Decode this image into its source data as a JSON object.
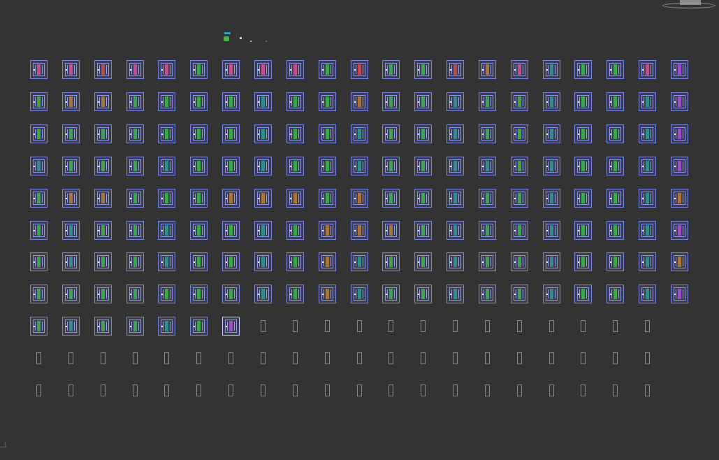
{
  "viewport": {
    "background": "#333333"
  },
  "colors": {
    "frame": "#7a84dd",
    "bar_green": "#3aa84a",
    "bar_pink": "#c24f8a",
    "bar_red": "#c0484c",
    "bar_teal": "#2f8f8f",
    "bar_orange": "#a8743a",
    "bar_purple": "#9a4fc8",
    "slot_outline": "#8a8a8a"
  },
  "icons": {
    "view_gizmo": "viewcube-gizmo-icon",
    "axis": "world-axis-icon"
  },
  "grid": {
    "filled_rows": [
      [
        "pink",
        "pink",
        "red",
        "pink",
        "pink",
        "green",
        "pink",
        "pink",
        "pink",
        "green",
        "red",
        "green",
        "green",
        "red",
        "orange",
        "pink",
        "teal",
        "green",
        "green",
        "pink",
        "purple"
      ],
      [
        "green",
        "orange",
        "orange",
        "green",
        "green",
        "green",
        "green",
        "teal",
        "green",
        "green",
        "orange",
        "green",
        "green",
        "teal",
        "green",
        "green",
        "teal",
        "green",
        "green",
        "teal",
        "purple"
      ],
      [
        "green",
        "green",
        "green",
        "green",
        "green",
        "green",
        "green",
        "teal",
        "green",
        "green",
        "teal",
        "green",
        "green",
        "teal",
        "green",
        "green",
        "teal",
        "green",
        "green",
        "teal",
        "purple"
      ],
      [
        "teal",
        "green",
        "green",
        "green",
        "teal",
        "green",
        "green",
        "teal",
        "green",
        "green",
        "teal",
        "green",
        "green",
        "teal",
        "teal",
        "green",
        "teal",
        "green",
        "green",
        "teal",
        "purple"
      ],
      [
        "green",
        "orange",
        "orange",
        "green",
        "green",
        "green",
        "orange",
        "orange",
        "orange",
        "green",
        "orange",
        "green",
        "green",
        "teal",
        "green",
        "green",
        "teal",
        "green",
        "green",
        "teal",
        "orange"
      ],
      [
        "green",
        "teal",
        "green",
        "green",
        "teal",
        "green",
        "green",
        "teal",
        "green",
        "orange",
        "orange",
        "orange",
        "green",
        "teal",
        "green",
        "green",
        "teal",
        "green",
        "green",
        "teal",
        "purple"
      ],
      [
        "green",
        "teal",
        "green",
        "green",
        "teal",
        "green",
        "green",
        "teal",
        "green",
        "orange",
        "teal",
        "green",
        "green",
        "teal",
        "green",
        "green",
        "teal",
        "green",
        "green",
        "teal",
        "orange"
      ],
      [
        "green",
        "green",
        "green",
        "green",
        "green",
        "green",
        "green",
        "teal",
        "green",
        "orange",
        "teal",
        "green",
        "green",
        "teal",
        "green",
        "green",
        "teal",
        "green",
        "green",
        "teal",
        "purple"
      ]
    ],
    "partial_row": [
      "green",
      "teal",
      "green",
      "green",
      "teal",
      "green",
      "purple"
    ],
    "empty_slots_row9": 13,
    "empty_rows": 2,
    "empty_slots_per_row": 20
  }
}
